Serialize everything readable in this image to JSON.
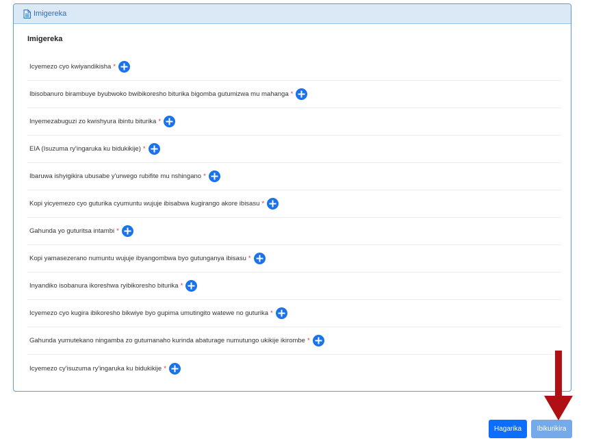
{
  "panel": {
    "header_title": "Imigereka",
    "section_title": "Imigereka",
    "required_mark": "*",
    "items": [
      {
        "label": "Icyemezo cyo kwiyandikisha"
      },
      {
        "label": "Ibisobanuro birambuye byubwoko bwibikoresho biturika bigomba gutumizwa mu mahanga"
      },
      {
        "label": "Inyemezabuguzi zo kwishyura ibintu biturika"
      },
      {
        "label": "EIA (Isuzuma ry'ingaruka ku bidukikije)"
      },
      {
        "label": "Ibaruwa ishyigikira ubusabe y'urwego rubifite mu nshingano"
      },
      {
        "label": "Kopi yicyemezo cyo guturika cyumuntu wujuje ibisabwa kugirango akore ibisasu"
      },
      {
        "label": "Gahunda yo guturitsa intambi"
      },
      {
        "label": "Kopi yamasezerano numuntu wujuje ibyangombwa byo gutunganya ibisasu"
      },
      {
        "label": "Inyandiko isobanura ikoreshwa ryibikoresho biturika"
      },
      {
        "label": "Icyemezo cyo kugira ibikoresho bikwiye byo gupima umutingito watewe no guturika"
      },
      {
        "label": "Gahunda yumutekano ningamba zo gutumanaho kurinda abaturage numutungo ukikije ikirombe"
      },
      {
        "label": "Icyemezo cy'isuzuma ry'ingaruka ku bidukikije"
      }
    ]
  },
  "footer": {
    "cancel_label": "Hagarika",
    "submit_label": "Ibikurikira"
  },
  "colors": {
    "primary": "#0d6efd",
    "submit_disabled": "#74a9ea",
    "header_bg": "#dbe9f7",
    "required": "#d33333",
    "annotation_arrow": "#b00f14"
  },
  "icons": {
    "header": "document-icon",
    "add": "plus-circle-icon",
    "annotation": "down-arrow-annotation"
  }
}
